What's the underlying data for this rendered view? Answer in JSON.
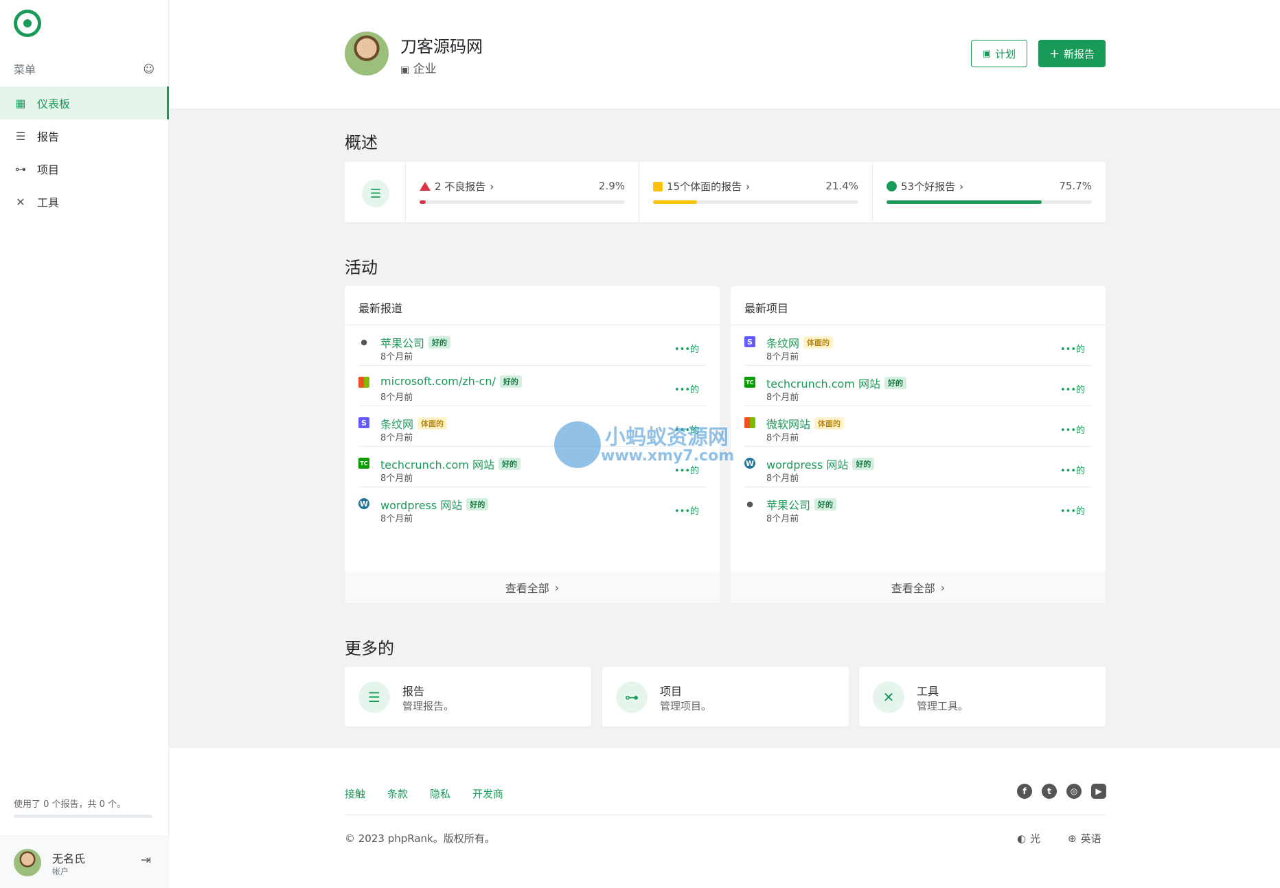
{
  "colors": {
    "accent": "#1a9a58",
    "bad": "#dc3545",
    "fair": "#ffc107"
  },
  "sidebar": {
    "menu_label": "菜单",
    "items": [
      {
        "label": "仪表板",
        "icon": "grid-icon",
        "active": true
      },
      {
        "label": "报告",
        "icon": "list-icon",
        "active": false
      },
      {
        "label": "项目",
        "icon": "project-icon",
        "active": false
      },
      {
        "label": "工具",
        "icon": "tools-icon",
        "active": false
      }
    ],
    "usage_text": "使用了 0 个报告，共 0 个。",
    "usage_fraction": 0,
    "user": {
      "name": "无名氏",
      "sub": "帐户"
    }
  },
  "header": {
    "org_name": "刀客源码网",
    "org_type": "企业",
    "plan_button": "计划",
    "new_report_button": "新报告"
  },
  "overview": {
    "title": "概述",
    "stats": [
      {
        "label": "2 不良报告",
        "percent": "2.9%",
        "fraction": 0.029,
        "kind": "bad"
      },
      {
        "label": "15个体面的报告",
        "percent": "21.4%",
        "fraction": 0.214,
        "kind": "fair"
      },
      {
        "label": "53个好报告",
        "percent": "75.7%",
        "fraction": 0.757,
        "kind": "good"
      }
    ]
  },
  "activity": {
    "title": "活动",
    "reports": {
      "title": "最新报道",
      "view_all": "查看全部",
      "rows": [
        {
          "title": "苹果公司",
          "badge": "好的",
          "badge_kind": "good",
          "time": "8个月前",
          "more": "•••的",
          "favicon": "apple"
        },
        {
          "title": "microsoft.com/zh-cn/",
          "badge": "好的",
          "badge_kind": "good",
          "time": "8个月前",
          "more": "•••的",
          "favicon": "microsoft"
        },
        {
          "title": "条纹网",
          "badge": "体面的",
          "badge_kind": "fair",
          "time": "8个月前",
          "more": "•••的",
          "favicon": "stripe"
        },
        {
          "title": "techcrunch.com 网站",
          "badge": "好的",
          "badge_kind": "good",
          "time": "8个月前",
          "more": "•••的",
          "favicon": "techcrunch"
        },
        {
          "title": "wordpress 网站",
          "badge": "好的",
          "badge_kind": "good",
          "time": "8个月前",
          "more": "•••的",
          "favicon": "wordpress"
        }
      ]
    },
    "projects": {
      "title": "最新项目",
      "view_all": "查看全部",
      "rows": [
        {
          "title": "条纹网",
          "badge": "体面的",
          "badge_kind": "fair",
          "time": "8个月前",
          "more": "•••的",
          "favicon": "stripe"
        },
        {
          "title": "techcrunch.com 网站",
          "badge": "好的",
          "badge_kind": "good",
          "time": "8个月前",
          "more": "•••的",
          "favicon": "techcrunch"
        },
        {
          "title": "微软网站",
          "badge": "体面的",
          "badge_kind": "fair",
          "time": "8个月前",
          "more": "•••的",
          "favicon": "microsoft"
        },
        {
          "title": "wordpress 网站",
          "badge": "好的",
          "badge_kind": "good",
          "time": "8个月前",
          "more": "•••的",
          "favicon": "wordpress"
        },
        {
          "title": "苹果公司",
          "badge": "好的",
          "badge_kind": "good",
          "time": "8个月前",
          "more": "•••的",
          "favicon": "apple"
        }
      ]
    }
  },
  "more": {
    "title": "更多的",
    "cards": [
      {
        "title": "报告",
        "desc": "管理报告。",
        "icon": "list-icon"
      },
      {
        "title": "项目",
        "desc": "管理项目。",
        "icon": "project-icon"
      },
      {
        "title": "工具",
        "desc": "管理工具。",
        "icon": "tools-icon"
      }
    ]
  },
  "watermark": {
    "line1": "小蚂蚁资源网",
    "line2": "www.xmy7.com"
  },
  "footer": {
    "links": [
      "接触",
      "条款",
      "隐私",
      "开发商"
    ],
    "copyright": "© 2023 phpRank。版权所有。",
    "theme": "光",
    "language": "英语",
    "social": [
      "facebook-icon",
      "twitter-icon",
      "instagram-icon",
      "youtube-icon"
    ]
  }
}
